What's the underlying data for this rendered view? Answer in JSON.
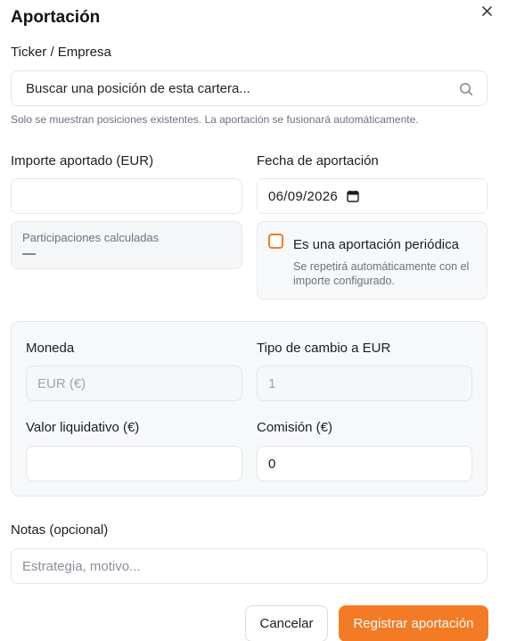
{
  "dialog": {
    "title": "Aportación",
    "close_icon": "close-icon"
  },
  "ticker": {
    "label": "Ticker / Empresa",
    "search_value": "Buscar una posición de esta cartera...",
    "search_icon": "search-icon",
    "hint": "Solo se muestran posiciones existentes. La aportación se fusionará automáticamente."
  },
  "amount": {
    "label": "Importe aportado (EUR)",
    "value": ""
  },
  "date": {
    "label": "Fecha de aportación",
    "value": "06/09/2026",
    "icon": "calendar-icon"
  },
  "calculated": {
    "label": "Participaciones calculadas",
    "value": "—"
  },
  "periodic": {
    "checked": false,
    "label": "Es una aportación periódica",
    "description": "Se repetirá automáticamente con el importe configurado."
  },
  "fx": {
    "currency_label": "Moneda",
    "currency_value": "EUR (€)",
    "rate_label": "Tipo de cambio a EUR",
    "rate_value": "1",
    "nav_label": "Valor liquidativo (€)",
    "nav_value": "",
    "fee_label": "Comisión (€)",
    "fee_value": "0"
  },
  "notes": {
    "label": "Notas (opcional)",
    "placeholder": "Estrategia, motivo..."
  },
  "actions": {
    "cancel_label": "Cancelar",
    "submit_label": "Registrar aportación"
  },
  "colors": {
    "accent": "#f47b26",
    "checkbox_border": "#f07b2a"
  }
}
